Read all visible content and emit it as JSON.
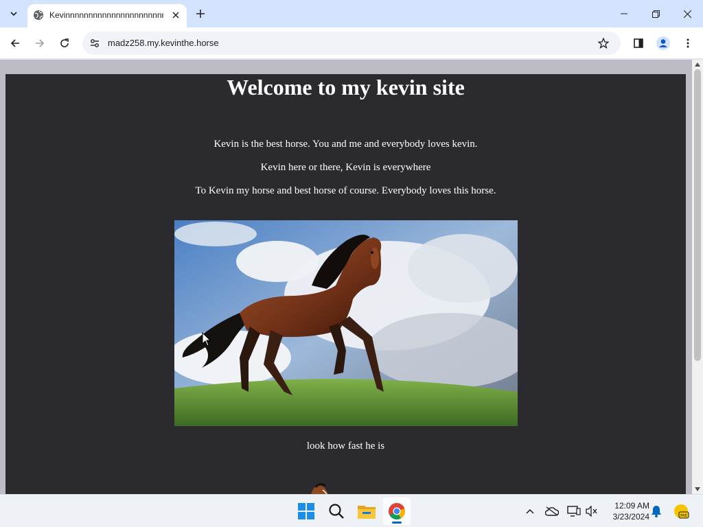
{
  "browser": {
    "tab": {
      "title": "Kevinnnnnnnnnnnnnnnnnnnnnnnnnn"
    },
    "url": "madz258.my.kevinthe.horse"
  },
  "page": {
    "heading": "Welcome to my kevin site",
    "paragraphs": [
      "Kevin is the best horse. You and me and everybody loves kevin.",
      "Kevin here or there, Kevin is everywhere",
      "To Kevin my horse and best horse of course. Everybody loves this horse."
    ],
    "image_caption": "look how fast he is",
    "image_subject": "galloping bay horse in a grassy field under a cloudy sky"
  },
  "taskbar": {
    "apps": [
      "start-menu",
      "search",
      "file-explorer",
      "chrome"
    ],
    "clock": {
      "time": "12:09 AM",
      "date": "3/23/2024"
    }
  },
  "colors": {
    "page_background": "#2b2a2f",
    "tabstrip": "#d3e3fd",
    "accent": "#0067c0"
  }
}
